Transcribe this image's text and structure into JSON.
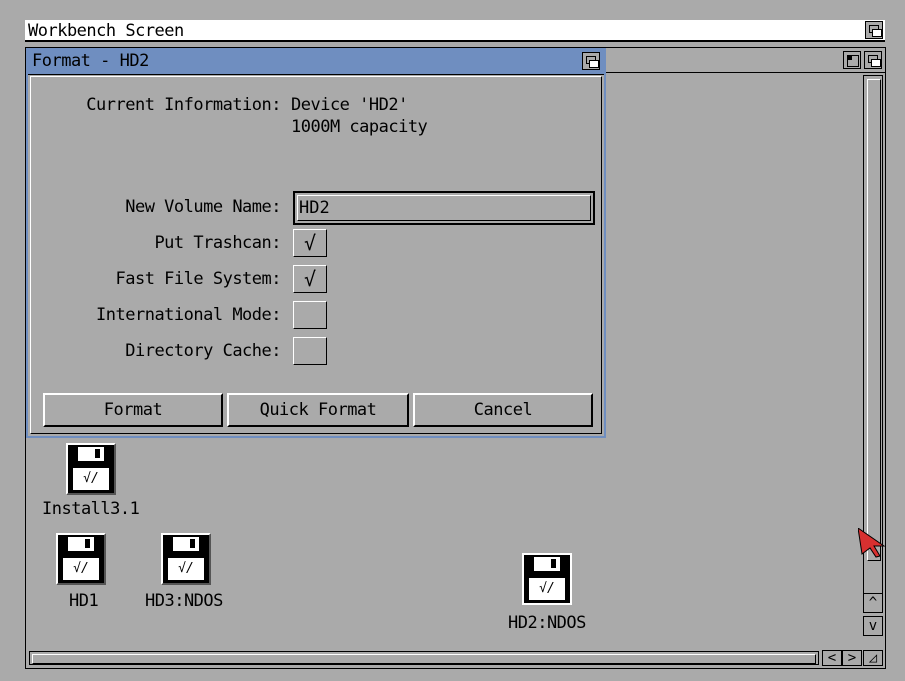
{
  "screen": {
    "title": "Workbench Screen"
  },
  "format_window": {
    "title": "Format - HD2",
    "current_info_label": "Current Information:",
    "device_line": "Device 'HD2'",
    "capacity_line": "1000M capacity",
    "volume_name_label": "New Volume Name:",
    "volume_name_value": "HD2",
    "options": [
      {
        "label": "Put Trashcan:",
        "checked": true
      },
      {
        "label": "Fast File System:",
        "checked": true
      },
      {
        "label": "International Mode:",
        "checked": false
      },
      {
        "label": "Directory Cache:",
        "checked": false
      }
    ],
    "check_glyph": "√",
    "buttons": {
      "format": "Format",
      "quick_format": "Quick Format",
      "cancel": "Cancel"
    }
  },
  "icons": [
    {
      "name": "Install3.1"
    },
    {
      "name": "HD1"
    },
    {
      "name": "HD3:NDOS"
    },
    {
      "name": "HD2:NDOS"
    }
  ],
  "disk_label_glyph": "√/",
  "scroll_arrows": {
    "up": "^",
    "down": "v",
    "left": "<",
    "right": ">"
  },
  "colors": {
    "window_active": "#6f8ec0",
    "background": "#aaaaaa",
    "cursor": "#d83030"
  }
}
